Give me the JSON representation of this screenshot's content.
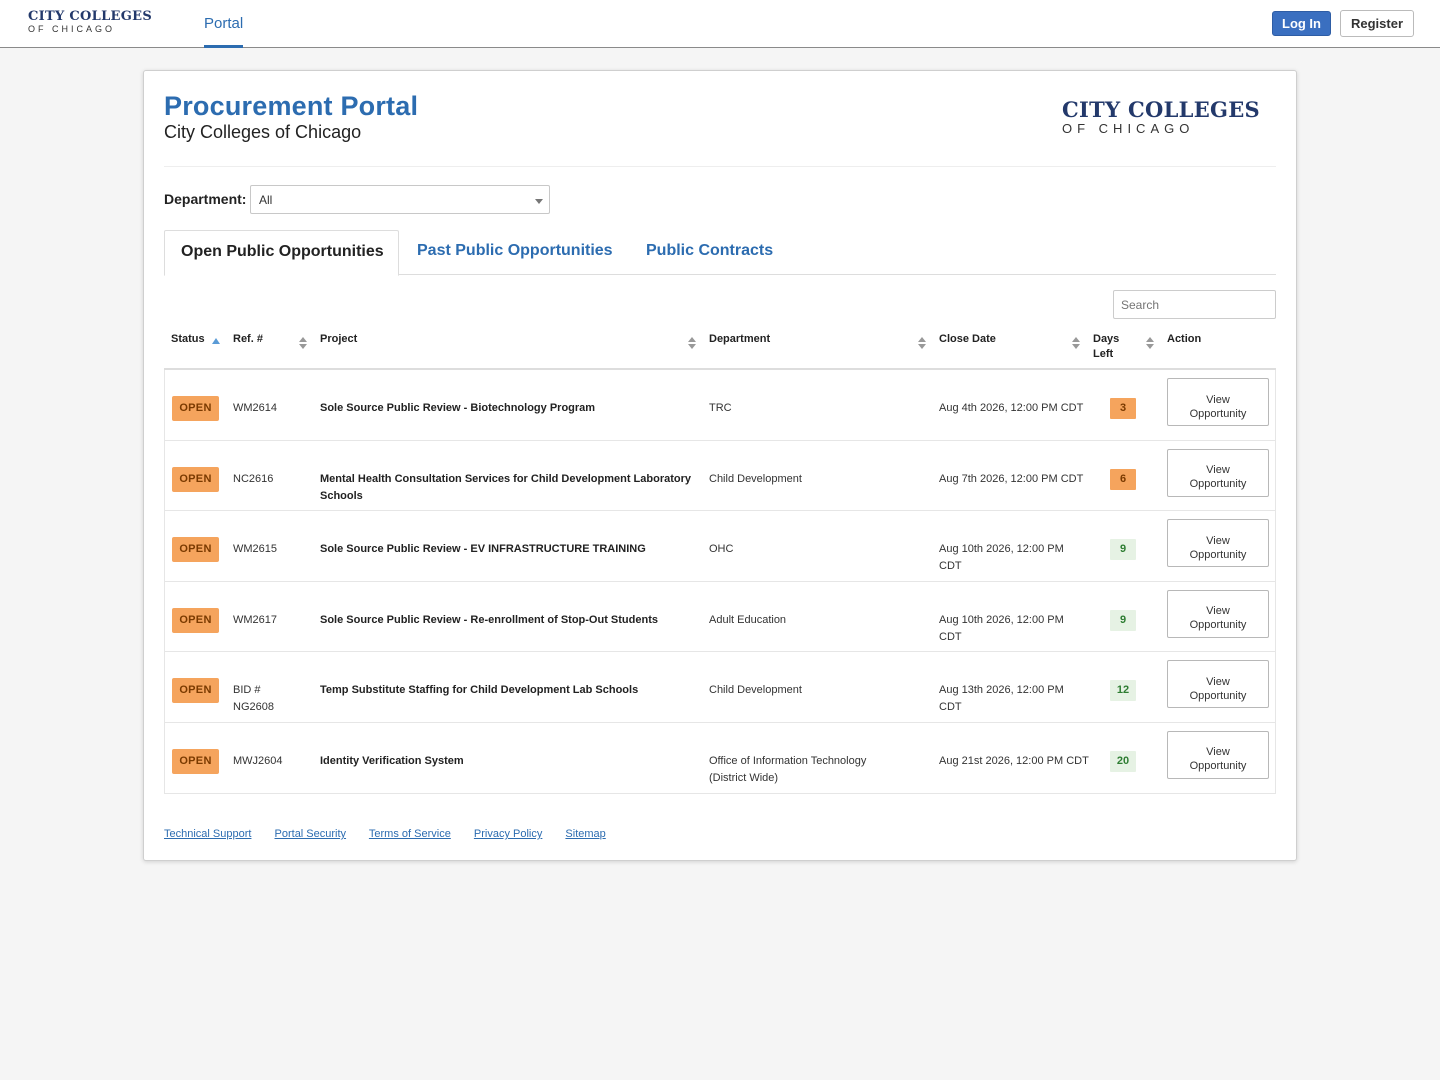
{
  "nav": {
    "logo_line1": "CITY COLLEGES",
    "logo_line2": "OF CHICAGO",
    "portal_link": "Portal",
    "login_label": "Log In",
    "register_label": "Register",
    "accent_color": "#2c6cb0"
  },
  "card": {
    "title": "Procurement Portal",
    "subtitle": "City Colleges of Chicago",
    "logo_line1": "CITY COLLEGES",
    "logo_line2": "OF CHICAGO"
  },
  "filter": {
    "department_label": "Department:",
    "department_value": "All"
  },
  "tabs": [
    {
      "label": "Open Public Opportunities",
      "active": true
    },
    {
      "label": "Past Public Opportunities",
      "active": false
    },
    {
      "label": "Public Contracts",
      "active": false
    }
  ],
  "search": {
    "placeholder": "Search"
  },
  "table": {
    "headers": {
      "status": "Status",
      "ref": "Ref. #",
      "project": "Project",
      "department": "Department",
      "close_date": "Close Date",
      "days_left_1": "Days",
      "days_left_2": "Left",
      "action": "Action"
    },
    "rows": [
      {
        "status": "OPEN",
        "ref": "WM2614",
        "project": "Sole Source Public Review - Biotechnology Program",
        "department": "TRC",
        "close_date": "Aug 4th 2026, 12:00 PM CDT",
        "days_left": "3",
        "days_state": "warn",
        "action": "View Opportunity"
      },
      {
        "status": "OPEN",
        "ref": "NC2616",
        "project": "Mental Health Consultation Services for Child Development Laboratory Schools",
        "department": "Child Development",
        "close_date": "Aug 7th 2026, 12:00 PM CDT",
        "days_left": "6",
        "days_state": "warn",
        "action": "View Opportunity"
      },
      {
        "status": "OPEN",
        "ref": "WM2615",
        "project": "Sole Source Public Review - EV INFRASTRUCTURE TRAINING",
        "department": "OHC",
        "close_date": "Aug 10th 2026, 12:00 PM CDT",
        "days_left": "9",
        "days_state": "ok",
        "action": "View Opportunity"
      },
      {
        "status": "OPEN",
        "ref": "WM2617",
        "project": "Sole Source Public Review - Re-enrollment of Stop-Out Students",
        "department": "Adult Education",
        "close_date": "Aug 10th 2026, 12:00 PM CDT",
        "days_left": "9",
        "days_state": "ok",
        "action": "View Opportunity"
      },
      {
        "status": "OPEN",
        "ref": "BID # NG2608",
        "project": "Temp Substitute Staffing for Child Development Lab Schools",
        "department": "Child Development",
        "close_date": "Aug 13th 2026, 12:00 PM CDT",
        "days_left": "12",
        "days_state": "ok",
        "action": "View Opportunity"
      },
      {
        "status": "OPEN",
        "ref": "MWJ2604",
        "project": "Identity Verification System",
        "department": "Office of Information Technology (District Wide)",
        "close_date": "Aug 21st 2026, 12:00 PM CDT",
        "days_left": "20",
        "days_state": "ok",
        "action": "View Opportunity"
      }
    ]
  },
  "footer": {
    "links": [
      "Technical Support",
      "Portal Security",
      "Terms of Service",
      "Privacy Policy",
      "Sitemap"
    ]
  }
}
